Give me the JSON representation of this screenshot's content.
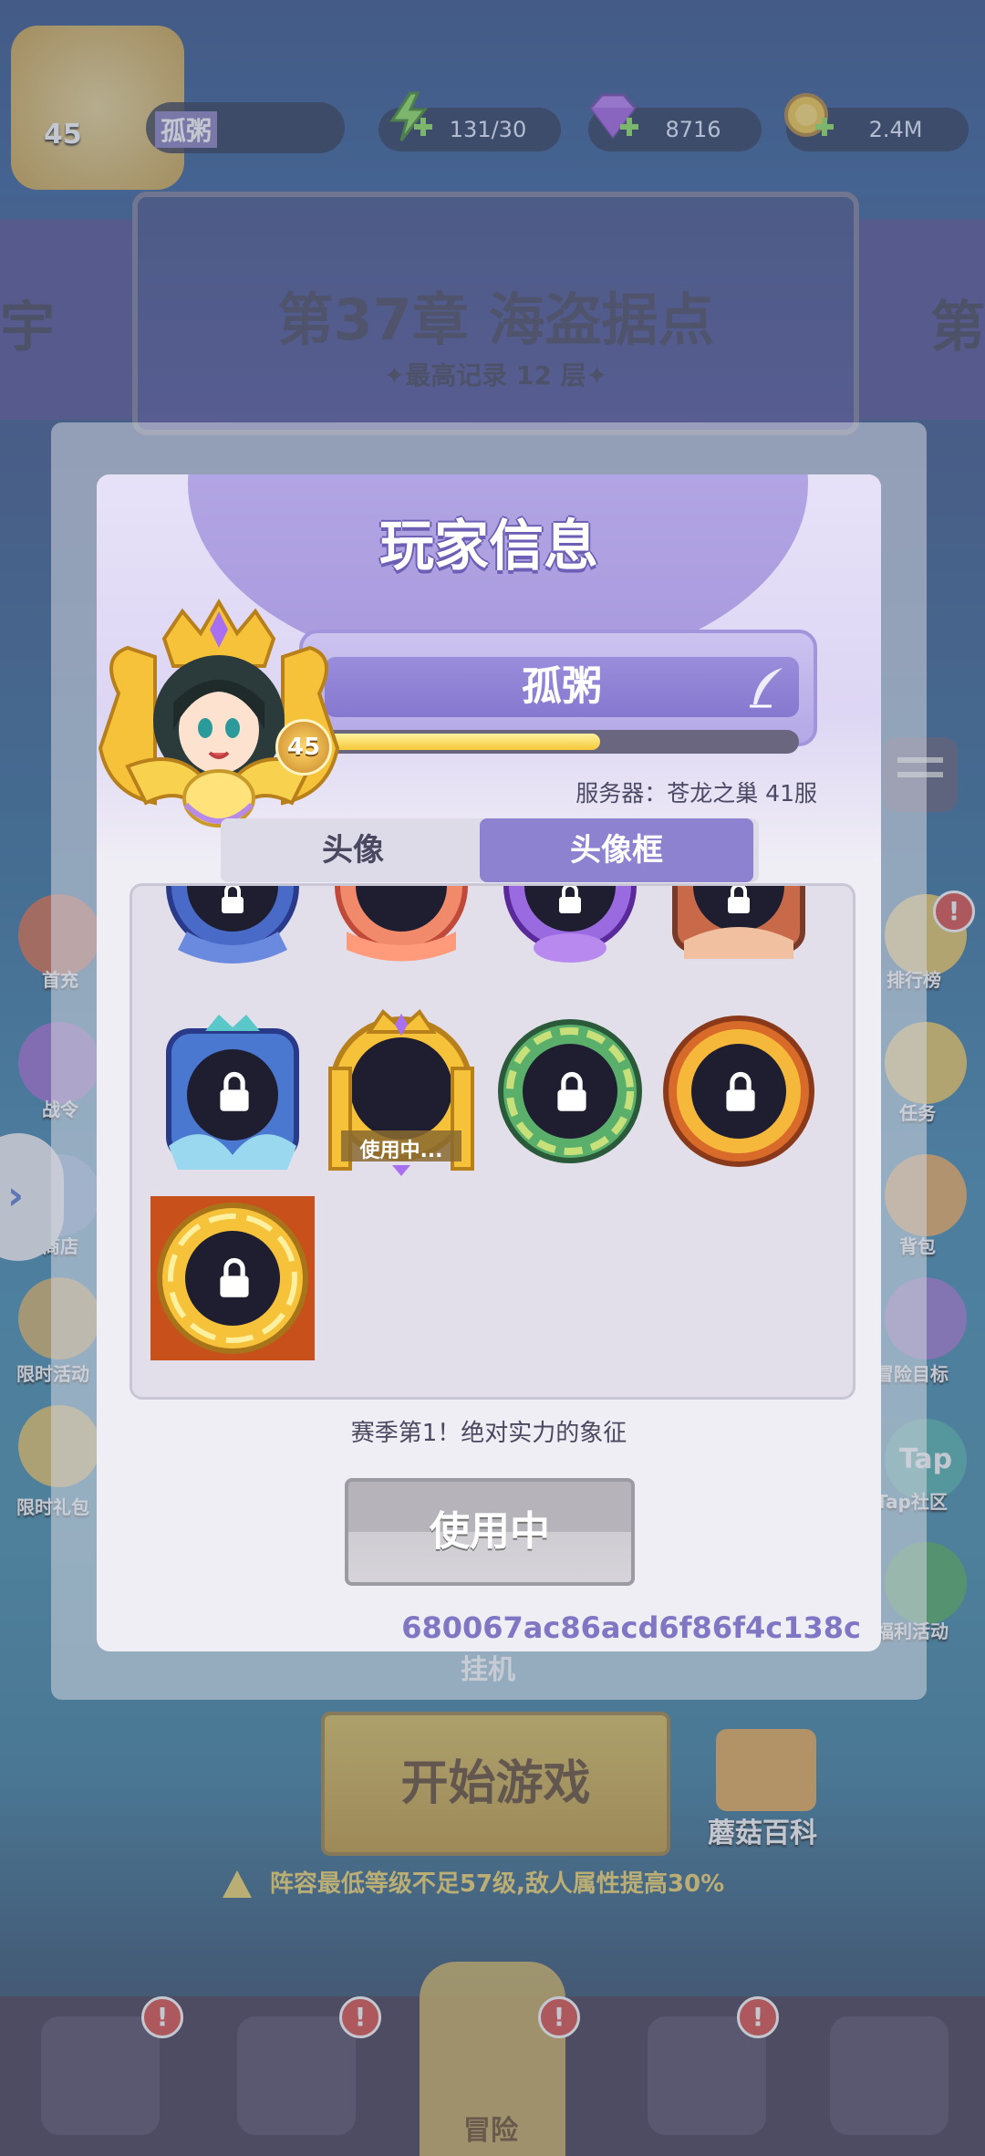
{
  "header": {
    "player_level": "45",
    "player_name": "孤粥",
    "energy": "131/30",
    "gems": "8716",
    "coins": "2.4M"
  },
  "chapter": {
    "title": "第37章 海盗据点",
    "record": "✦最高记录 12 层✦",
    "left_fragment": "宇",
    "right_fragment": "第"
  },
  "side_left": [
    "首充",
    "战令",
    "商店",
    "限时活动",
    "限时礼包"
  ],
  "side_right": [
    "排行榜",
    "任务",
    "背包",
    "冒险目标",
    "Tap社区",
    "福利活动"
  ],
  "side_right_tap_logo": "Tap",
  "idle_label": "挂机",
  "start_button": "开始游戏",
  "mushroom_wiki": "蘑菇百科",
  "warning": "阵容最低等级不足57级,敌人属性提高30%",
  "bottom_nav": {
    "center_label": "冒险",
    "badge": "!"
  },
  "dialog": {
    "title": "玩家信息",
    "name": "孤粥",
    "level": "45",
    "exp_fraction": 0.59,
    "server": "服务器：苍龙之巢 41服",
    "tabs": [
      "头像",
      "头像框"
    ],
    "active_tab": "头像框",
    "in_use_tag": "使用中...",
    "description": "赛季第1！绝对实力的象征",
    "use_button": "使用中",
    "uid": "680067ac86acd6f86f4c138c"
  },
  "colors": {
    "accent_purple": "#8d82d0",
    "gold": "#f6c938",
    "uid_text": "#7f76c4"
  },
  "icons": {
    "lock": "lock-icon",
    "edit": "feather-edit-icon",
    "energy": "lightning-icon",
    "gem": "gem-icon",
    "coin": "coin-icon",
    "warning": "warning-icon"
  }
}
